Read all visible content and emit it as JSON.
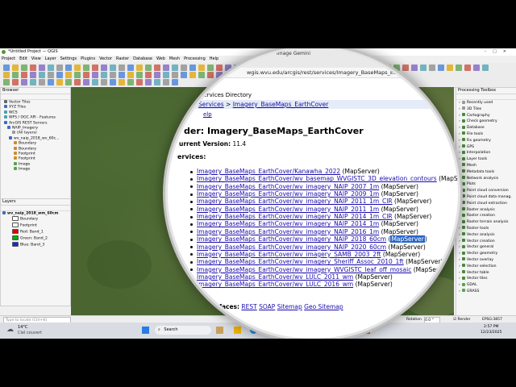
{
  "window": {
    "title": "*Untitled Project — QGIS"
  },
  "menu": [
    "Project",
    "Edit",
    "View",
    "Layer",
    "Settings",
    "Plugins",
    "Vector",
    "Raster",
    "Database",
    "Web",
    "Mesh",
    "Processing",
    "Help"
  ],
  "browser": {
    "title": "Browser",
    "items": [
      "Vector Tiles",
      "XYZ Tiles",
      "WCS",
      "WFS / OGC API - Features",
      "ArcGIS REST Servers",
      "NAIP_Imagery",
      "(All layers)",
      "wv_naip_2018_wv_60c...",
      "Boundary",
      "Boundary",
      "Footprint",
      "Footprint",
      "Image",
      "Image"
    ]
  },
  "layers": {
    "title": "Layers",
    "group": "wv_naip_2018_wm_60cm",
    "items": [
      "Boundary",
      "Footprint",
      "Red: Band_1",
      "Green: Band_2",
      "Blue: Band_3"
    ]
  },
  "processing": {
    "title": "Processing Toolbox",
    "items": [
      "Recently used",
      "3D Tiles",
      "Cartography",
      "Check geometry",
      "Database",
      "File tools",
      "Fix geometry",
      "GPS",
      "Interpolation",
      "Layer tools",
      "Mesh",
      "Metadata tools",
      "Network analysis",
      "Plots",
      "Point cloud conversion",
      "Point cloud data manag.",
      "Point cloud extraction",
      "Raster analysis",
      "Raster creation",
      "Raster terrain analysis",
      "Raster tools",
      "Vector analysis",
      "Vector creation",
      "Vector general",
      "Vector geometry",
      "Vector overlay",
      "Vector selection",
      "Vector table",
      "Vector tiles",
      "GDAL",
      "GRASS"
    ]
  },
  "browserwin": {
    "topbar": "Image Gemini",
    "url": "wgis.wvu.edu/arcgis/rest/services/Imagery_BaseMaps_Earth...",
    "heading_small": "Services Directory",
    "breadcrumb_home": "Services",
    "breadcrumb_sep": ">",
    "breadcrumb_current": "Imagery_BaseMaps_EarthCover",
    "help": "elp",
    "folder": "der: Imagery_BaseMaps_EarthCover",
    "version_label": "urrent Version:",
    "version": "11.4",
    "services_label": "ervices:",
    "services": [
      {
        "name": "Imagery_BaseMaps_EarthCover/Kanawha_2022",
        "type": "(MapServer)"
      },
      {
        "name": "Imagery_BaseMaps_EarthCover/wv_basemap_WVGISTC_3D_elevation_contours",
        "type": "(MapServer)"
      },
      {
        "name": "Imagery_BaseMaps_EarthCover/wv_imagery_NAIP_2007_1m",
        "type": "(MapServer)"
      },
      {
        "name": "Imagery_BaseMaps_EarthCover/wv_imagery_NAIP_2009_1m",
        "type": "(MapServer)"
      },
      {
        "name": "Imagery_BaseMaps_EarthCover/wv_imagery_NAIP_2011_1m_CIR",
        "type": "(MapServer)"
      },
      {
        "name": "Imagery_BaseMaps_EarthCover/wv_imagery_NAIP_2011_1m",
        "type": "(MapServer)"
      },
      {
        "name": "Imagery_BaseMaps_EarthCover/wv_imagery_NAIP_2014_1m_CIR",
        "type": "(MapServer)"
      },
      {
        "name": "Imagery_BaseMaps_EarthCover/wv_imagery_NAIP_2014_1m",
        "type": "(MapServer)"
      },
      {
        "name": "Imagery_BaseMaps_EarthCover/wv_imagery_NAIP_2016_1m",
        "type": "(MapServer)"
      },
      {
        "name": "Imagery_BaseMaps_EarthCover/wv_imagery_NAIP_2018_60cm",
        "type": "(MapServer)"
      },
      {
        "name": "Imagery_BaseMaps_EarthCover/wv_imagery_NAIP_2020_60cm",
        "type": "(MapServer)"
      },
      {
        "name": "Imagery_BaseMaps_EarthCover/wv_imagery_SAMB_2003_2ft",
        "type": "(MapServer)"
      },
      {
        "name": "Imagery_BaseMaps_EarthCover/wv_imagery_Sheriff_Assoc_2010_1ft",
        "type": "(MapServer)"
      },
      {
        "name": "Imagery_BaseMaps_EarthCover/wv_imagery_WVGISTC_leaf_off_mosaic",
        "type": "(MapServer)"
      },
      {
        "name": "Imagery_BaseMaps_EarthCover/wv_LULC_2011_wm",
        "type": "(MapServer)"
      },
      {
        "name": "Imagery_BaseMaps_EarthCover/wv_LULC_2016_wm",
        "type": "(MapServer)"
      }
    ],
    "highlight_index": 9,
    "highlight_text": "MapServer",
    "supported_label": "rfaces:",
    "interfaces": [
      "REST",
      "SOAP",
      "Sitemap",
      "Geo Sitemap"
    ]
  },
  "status": {
    "locate_placeholder": "Type to locate (Ctrl+K)",
    "rotation_label": "Rotation",
    "rotation": "0.0 °",
    "render": "Render",
    "crs": "EPSG:3857"
  },
  "taskbar": {
    "temp": "14°C",
    "weather": "Ciel couvert",
    "search": "Search",
    "time": "2:57 PM",
    "date": "12/23/2025"
  },
  "colors": {
    "highlight": "#2965c8",
    "link": "#1a0dab",
    "map": "#4a6530"
  }
}
